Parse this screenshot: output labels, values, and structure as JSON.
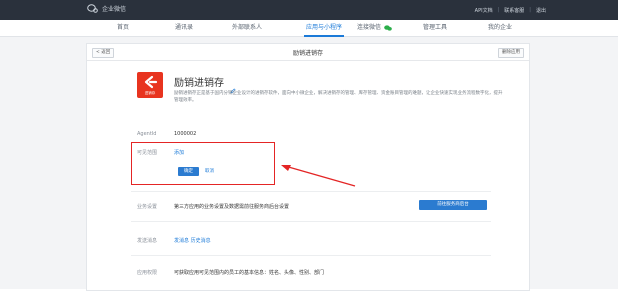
{
  "topbar": {
    "brand": "企业微信",
    "links": [
      "API文档",
      "联系客服",
      "退出"
    ]
  },
  "nav": {
    "items": [
      {
        "label": "首页"
      },
      {
        "label": "通讯录"
      },
      {
        "label": "外部联系人"
      },
      {
        "label": "应用与小程序",
        "active": true
      },
      {
        "label": "连接微信"
      },
      {
        "label": "管理工具"
      },
      {
        "label": "我的企业"
      }
    ]
  },
  "panel": {
    "back_label": "< 返回",
    "title": "励销进销存",
    "manage_label": "删除应用"
  },
  "app": {
    "logo_text": "进销存",
    "name": "励销进销存",
    "description": "励销进销存正是基于国内分销企业设计的进销存软件，面向中小微企业，解决进销存的管理、库存管理、资金账目管理的难题，让企业快速实现业务流程数字化，提升管理效率。"
  },
  "fields": {
    "agentid_label": "AgentId",
    "agentid_value": "1000002",
    "visible_label": "可见范围",
    "visible_value": "添加",
    "confirm_label": "确定",
    "cancel_label": "取消",
    "business_label": "业务设置",
    "business_value": "第三方应用的业务设置及数据需前往服务商后台设置",
    "business_button": "前往服务商后台",
    "message_label": "发送消息",
    "message_links": [
      "发消息",
      "历史消息"
    ],
    "permission_label": "应用权限",
    "permission_value": "可获取应用可见范围内的员工的基本信息：姓名、头像、性别、部门"
  },
  "colors": {
    "topbar": "#2a313c",
    "accent": "#1b7ad8",
    "logo": "#e8341f",
    "annotation": "#e42525"
  }
}
